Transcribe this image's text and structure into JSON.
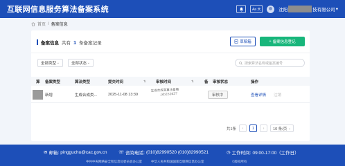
{
  "header": {
    "title": "互联网信息服务算法备案系统",
    "bell_icon": "bell-icon",
    "font_size_label": "Aa 大",
    "company_prefix": "沈阳",
    "company_suffix": "技有限公司",
    "dropdown_icon": "chevron-down-icon"
  },
  "breadcrumb": {
    "home": "首页",
    "separator": "/",
    "current": "备案信息"
  },
  "card": {
    "title": "备案信息",
    "count_prefix": "共有",
    "count": "1",
    "count_suffix": "条备案记录",
    "draft_button": "草稿箱",
    "register_button": "备案信息登记"
  },
  "filters": {
    "type_select": "全部类型",
    "status_select": "全部状态",
    "search_placeholder": "搜索算法名称或备案编号"
  },
  "table": {
    "headers": [
      "算",
      "备案类型",
      "算法类型",
      "提交时间",
      "审核时间",
      "备",
      "审核状态",
      "操作"
    ],
    "rows": [
      {
        "filing_type": "新增",
        "algorithm_type": "生成合成类...",
        "submit_time": "2025-11-08 13:39",
        "stamp_line1": "生成合成类算法备案",
        "stamp_line2": "jxb252637",
        "status": "审核中",
        "action_view": "查看详情",
        "action_cancel": "注销"
      }
    ]
  },
  "pagination": {
    "total": "共1条",
    "prev": "‹",
    "page": "1",
    "next": "›",
    "page_size": "10 条/页"
  },
  "footer": {
    "email_label": "邮箱:",
    "email": "pingguchu@cac.gov.cn",
    "phone_label": "咨询电话:",
    "phone": "(010)82990520 (010)82990521",
    "hours_label": "工作时间:",
    "hours": "09:00-17:00（工作日）",
    "org1": "中共中央网络安全和信息化委员会办公室",
    "org2": "中华人民共和国国家互联网信息办公室",
    "copyright": "©版权所有"
  },
  "colors": {
    "brand": "#1d4fb8",
    "success": "#18b67b"
  }
}
